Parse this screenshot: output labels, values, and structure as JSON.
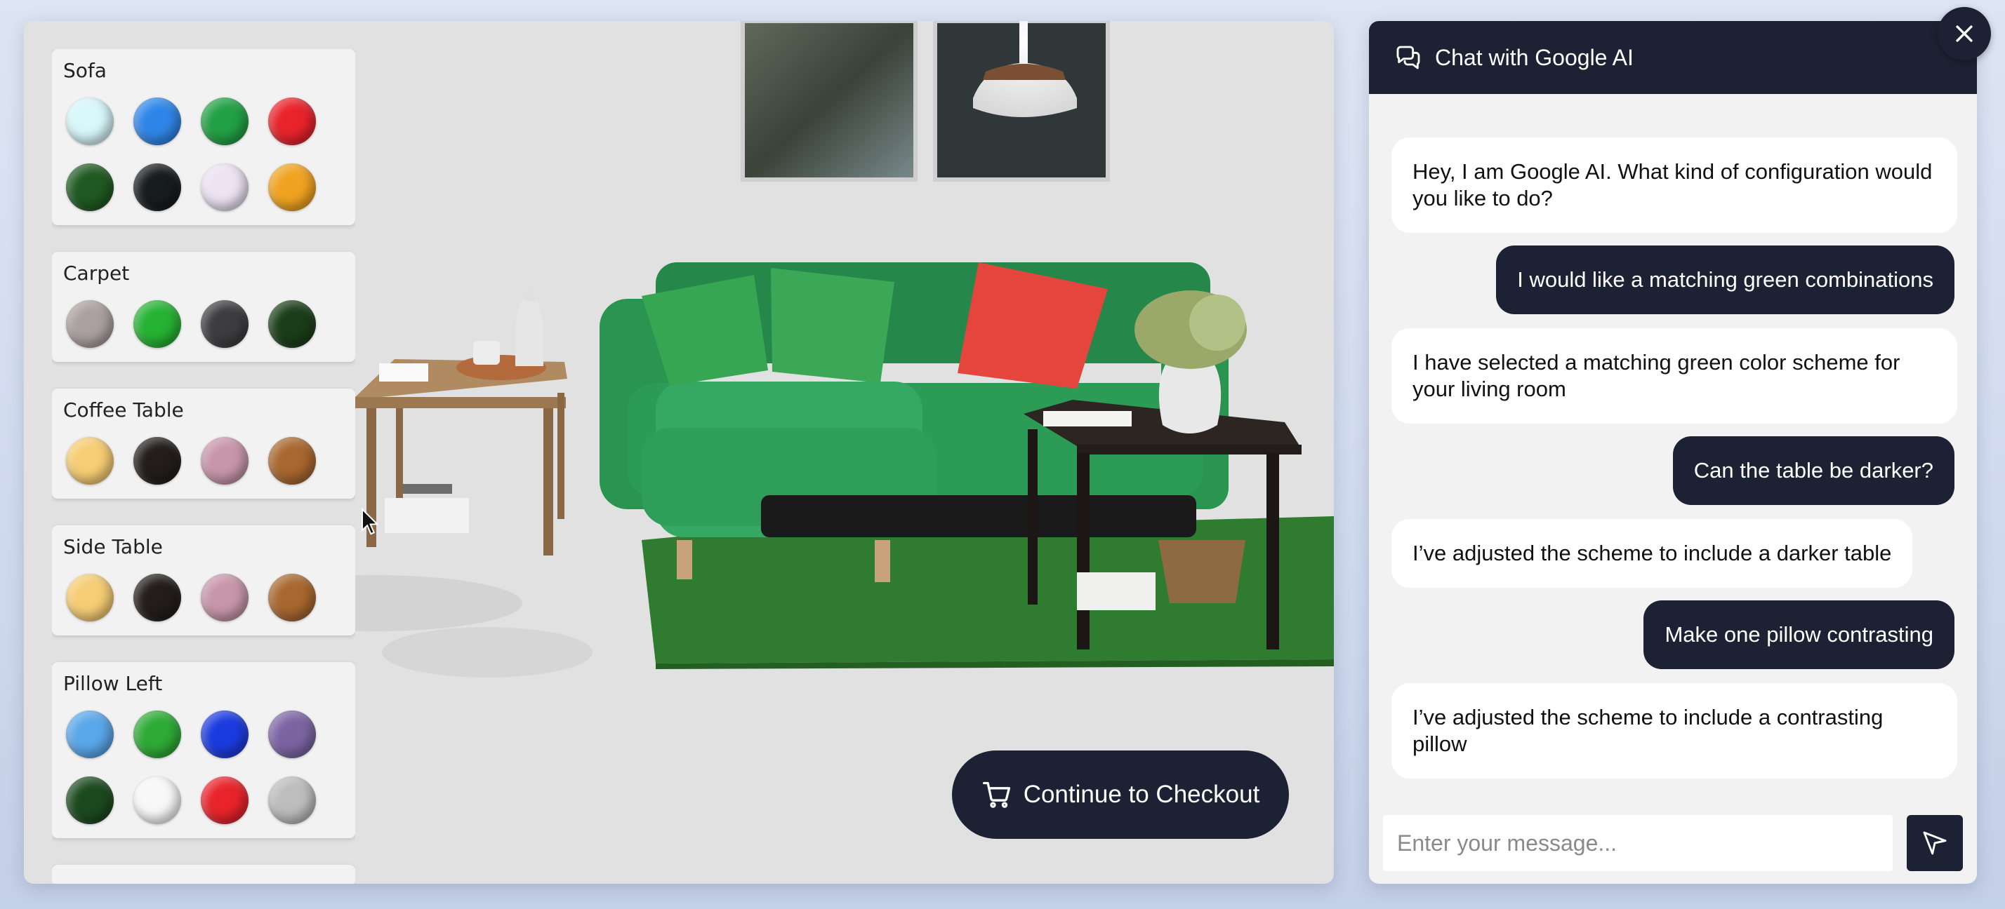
{
  "options": [
    {
      "title": "Sofa",
      "swatches": [
        "#d7f7fa",
        "#2f86e8",
        "#22a045",
        "#e8232b",
        "#1f5a22",
        "#171c1f",
        "#ece3f3",
        "#f0a320"
      ]
    },
    {
      "title": "Carpet",
      "swatches": [
        "#aaa09f",
        "#26b233",
        "#3d3d3f",
        "#1b3e18"
      ]
    },
    {
      "title": "Coffee Table",
      "swatches": [
        "#f6cd74",
        "#221d1b",
        "#c796a8",
        "#a8672e"
      ]
    },
    {
      "title": "Side Table",
      "swatches": [
        "#f6cd74",
        "#221d1b",
        "#c796a8",
        "#a8672e"
      ]
    },
    {
      "title": "Pillow Left",
      "swatches": [
        "#5aa7e9",
        "#2eab36",
        "#1c3bdf",
        "#7c64a3",
        "#1c4a1f",
        "#f8f8f8",
        "#e8232b",
        "#bdbdbd"
      ]
    }
  ],
  "checkout_label": "Continue to Checkout",
  "chat": {
    "title": "Chat with Google AI",
    "messages": [
      {
        "role": "ai",
        "text": "Hey, I am Google AI. What kind of configuration would you like to do?"
      },
      {
        "role": "user",
        "text": "I would like a matching green combinations"
      },
      {
        "role": "ai",
        "text": "I have selected a matching green color scheme for your living room"
      },
      {
        "role": "user",
        "text": "Can the table be darker?"
      },
      {
        "role": "ai",
        "text": "I’ve adjusted the scheme to include a darker table"
      },
      {
        "role": "user",
        "text": "Make one pillow contrasting"
      },
      {
        "role": "ai",
        "text": "I’ve adjusted the scheme to include a contrasting pillow"
      }
    ],
    "input_placeholder": "Enter your message..."
  },
  "icons": {
    "checkout": "cart-icon",
    "header": "chat-bubbles-icon",
    "send": "send-icon",
    "close": "close-icon"
  }
}
